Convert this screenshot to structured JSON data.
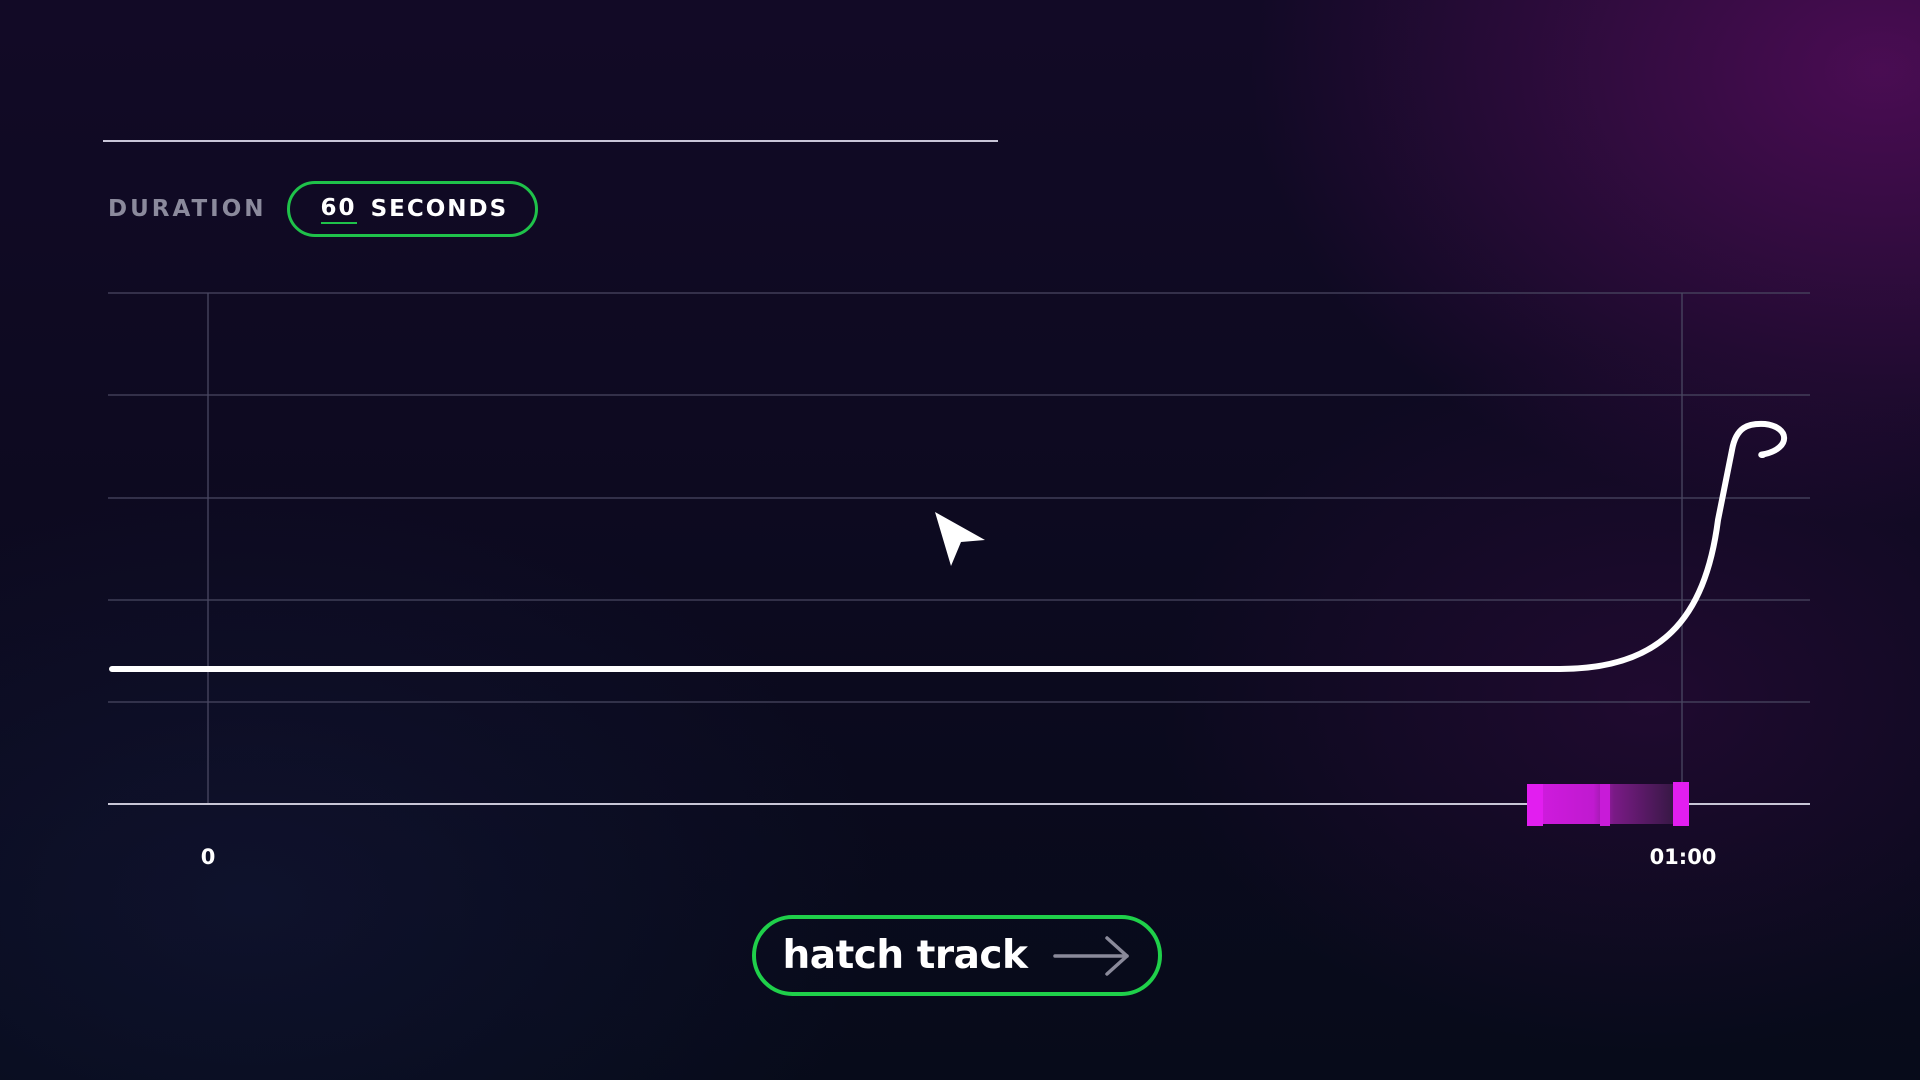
{
  "duration": {
    "label": "DURATION",
    "value": "60",
    "unit": "SECONDS"
  },
  "timeline": {
    "start_label": "0",
    "end_label": "01:00",
    "range_seconds": [
      0,
      60
    ],
    "selection_seconds": [
      54.4,
      60
    ]
  },
  "colors": {
    "accent_green": "#1fc24a",
    "selection_magenta": "#d21be0",
    "curve": "#ffffff"
  },
  "icons": {
    "cursor": "mouse-pointer-icon",
    "arrow": "arrow-right-icon"
  },
  "cta": {
    "label": "hatch track"
  }
}
